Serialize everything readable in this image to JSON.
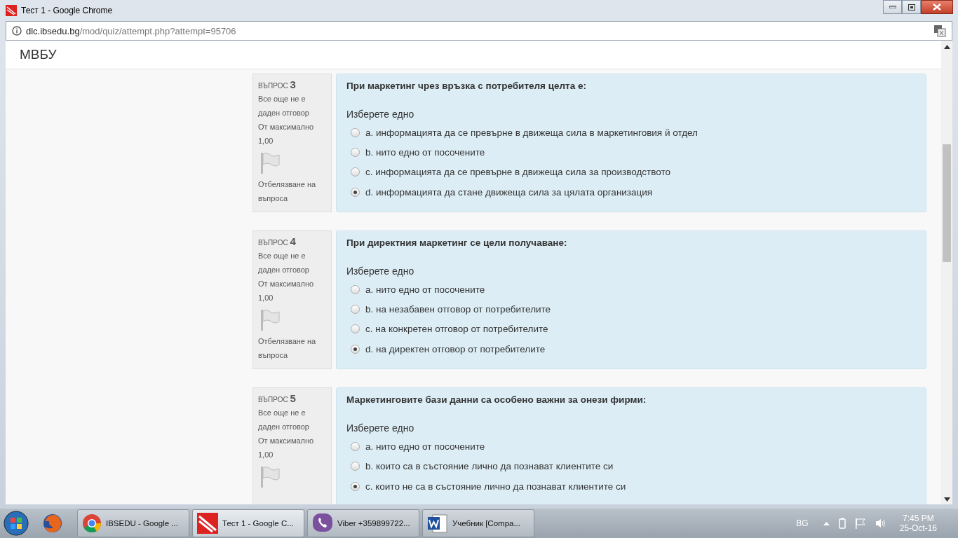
{
  "window": {
    "title": "Тест 1 - Google Chrome"
  },
  "address_bar": {
    "host": "dlc.ibsedu.bg",
    "path": "/mod/quiz/attempt.php?attempt=95706"
  },
  "site": {
    "title": "МВБУ"
  },
  "questions": [
    {
      "label": "ВЪПРОС",
      "number": "3",
      "status": "Все още не е даден отговор",
      "max_label": "От максимално",
      "max_value": "1,00",
      "flag_label": "Отбелязване на въпроса",
      "text": "При маркетинг чрез връзка с потребителя целта е:",
      "prompt": "Изберете едно",
      "options": [
        {
          "text": "a. информацията да се превърне в движеща сила в маркетинговия й отдел",
          "selected": false
        },
        {
          "text": "b. нито едно от посочените",
          "selected": false
        },
        {
          "text": "c. информацията да се превърне в движеща сила за производството",
          "selected": false
        },
        {
          "text": "d. информацията да стане движеща сила за цялата организация",
          "selected": true
        }
      ]
    },
    {
      "label": "ВЪПРОС",
      "number": "4",
      "status": "Все още не е даден отговор",
      "max_label": "От максимално",
      "max_value": "1,00",
      "flag_label": "Отбелязване на въпроса",
      "text": "При директния маркетинг се цели получаване:",
      "prompt": "Изберете едно",
      "options": [
        {
          "text": "a. нито едно от посочените",
          "selected": false
        },
        {
          "text": "b. на незабавен отговор от потребителите",
          "selected": false
        },
        {
          "text": "c. на конкретен отговор от потребителите",
          "selected": false
        },
        {
          "text": "d. на директен отговор от потребителите",
          "selected": true
        }
      ]
    },
    {
      "label": "ВЪПРОС",
      "number": "5",
      "status": "Все още не е даден отговор",
      "max_label": "От максимално",
      "max_value": "1,00",
      "text": "Маркетинговите бази данни са особено важни за онези фирми:",
      "prompt": "Изберете едно",
      "options": [
        {
          "text": "a. нито едно от посочените",
          "selected": false
        },
        {
          "text": "b. които са в състояние лично да познават клиентите си",
          "selected": false
        },
        {
          "text": "c. които не са в състояние лично да познават клиентите си",
          "selected": true
        }
      ]
    }
  ],
  "taskbar": {
    "items": [
      {
        "kind": "chrome",
        "label": "IBSEDU - Google ...",
        "selected": false
      },
      {
        "kind": "app",
        "label": "Тест 1 - Google C...",
        "selected": true
      },
      {
        "kind": "viber",
        "label": "Viber +359899722...",
        "selected": false
      },
      {
        "kind": "word",
        "label": "Учебник [Compa...",
        "selected": false
      }
    ],
    "language": "BG",
    "time": "7:45 PM",
    "date": "25-Oct-16"
  }
}
